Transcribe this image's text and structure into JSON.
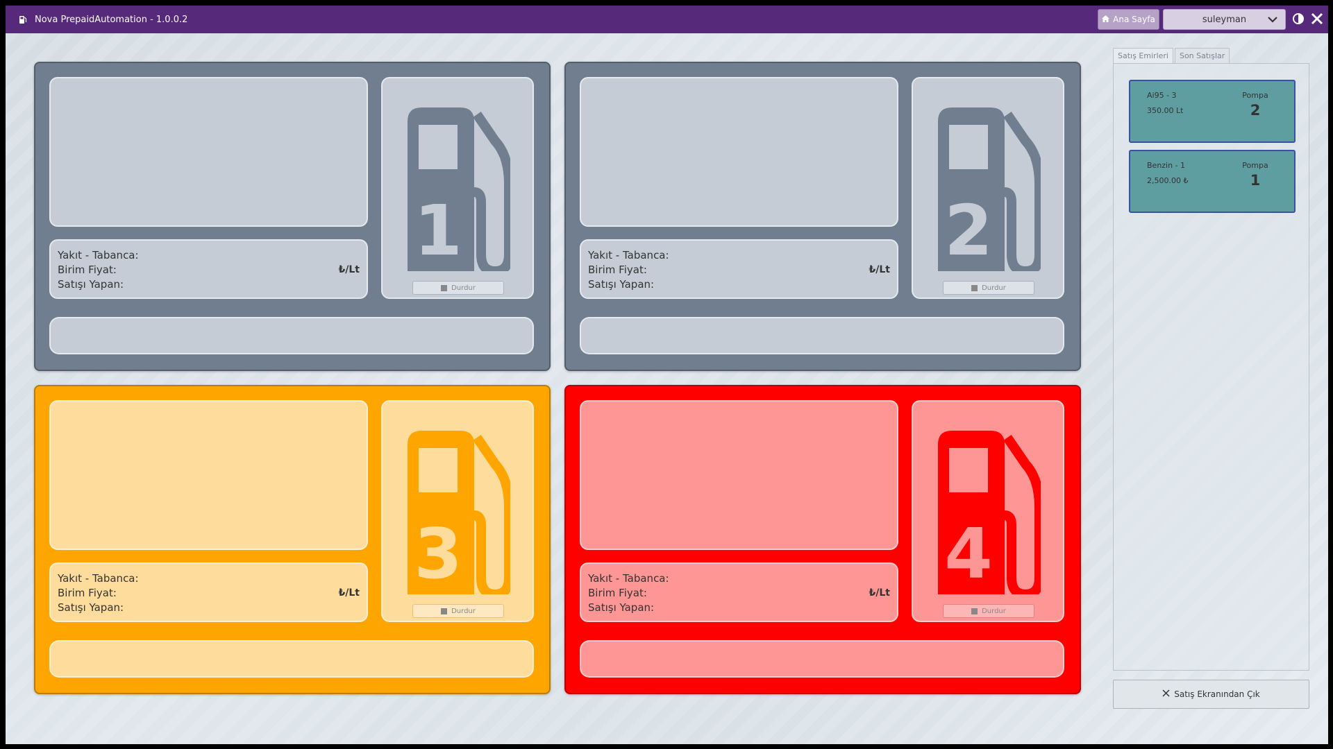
{
  "window": {
    "title": "Nova PrepaidAutomation - 1.0.0.2"
  },
  "header": {
    "home_label": "Ana Sayfa",
    "user": "suleyman"
  },
  "labels": {
    "fuel_nozzle": "Yakıt - Tabanca:",
    "unit_price": "Birim Fiyat:",
    "unit": "₺/Lt",
    "seller": "Satışı Yapan:",
    "stop": "Durdur"
  },
  "pumps": [
    {
      "number": "1",
      "state_color": "#707e8f",
      "icon_color": "#707e8f"
    },
    {
      "number": "2",
      "state_color": "#707e8f",
      "icon_color": "#707e8f"
    },
    {
      "number": "3",
      "state_color": "#ffa500",
      "icon_color": "#ffa500"
    },
    {
      "number": "4",
      "state_color": "#ff0000",
      "icon_color": "#ff0000"
    }
  ],
  "tabs": [
    {
      "label": "Satış Emirleri",
      "active": true
    },
    {
      "label": "Son Satışlar",
      "active": false
    }
  ],
  "orders": [
    {
      "fuel": "Ai95 - 3",
      "amount": "350.00 Lt",
      "pompa_label": "Pompa",
      "pompa": "2"
    },
    {
      "fuel": "Benzin - 1",
      "amount": "2,500.00 ₺",
      "pompa_label": "Pompa",
      "pompa": "1"
    }
  ],
  "exit_button": "Satış Ekranından Çık",
  "colors": {
    "titlebar": "#56297a",
    "order_card": "#5f9ea0",
    "order_border": "#3a4fa6"
  }
}
